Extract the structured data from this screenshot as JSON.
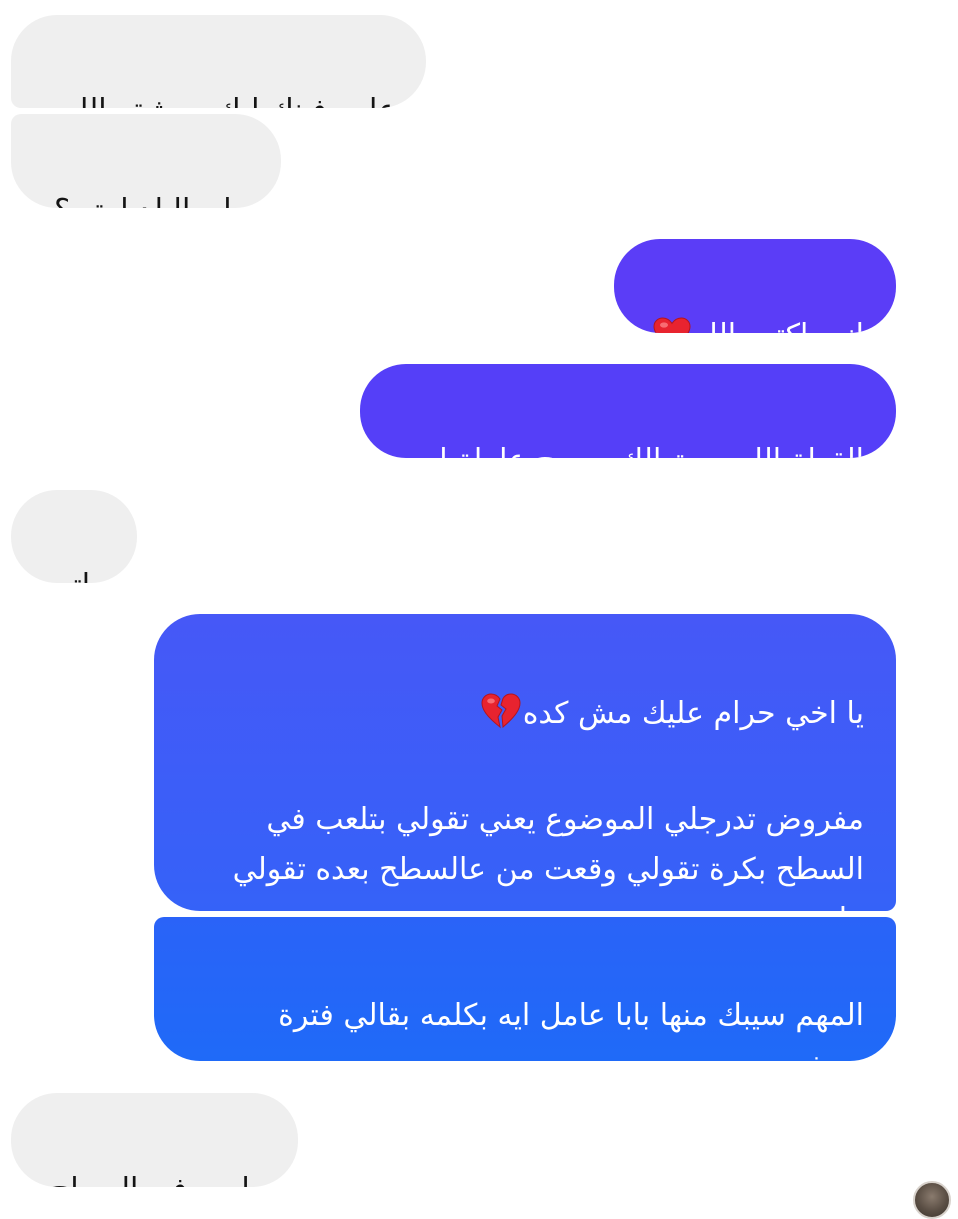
{
  "colors": {
    "incoming_bubble": "#efefef",
    "outgoing_purple": "#5b3df7",
    "outgoing_blue_top": "#3d5af8",
    "outgoing_blue_bottom": "#1f6af8"
  },
  "messages": [
    {
      "direction": "incoming",
      "text": "عامر فينك ليك وحشة والله"
    },
    {
      "direction": "incoming",
      "text": "جاي البلد امتى؟"
    },
    {
      "direction": "outgoing",
      "text": "انت اكتر والله",
      "emoji": "red-heart-icon"
    },
    {
      "direction": "outgoing",
      "text": "القطة اللي سبتهالك صحيح عاملة ايه"
    },
    {
      "direction": "incoming",
      "text": "ماتت"
    },
    {
      "direction": "outgoing",
      "line1": "يا اخي حرام عليك مش كده",
      "emoji": "broken-heart-icon",
      "text": "مفروض تدرجلي الموضوع يعني تقولي بتلعب في السطح بكرة تقولي وقعت من عالسطح بعده تقولي ماتت\nكده"
    },
    {
      "direction": "outgoing",
      "text": "المهم سيبك منها بابا عامل ايه بكلمه بقالي فترة ومش بيرد"
    },
    {
      "direction": "incoming",
      "text": "بيلعب في السطح"
    }
  ]
}
